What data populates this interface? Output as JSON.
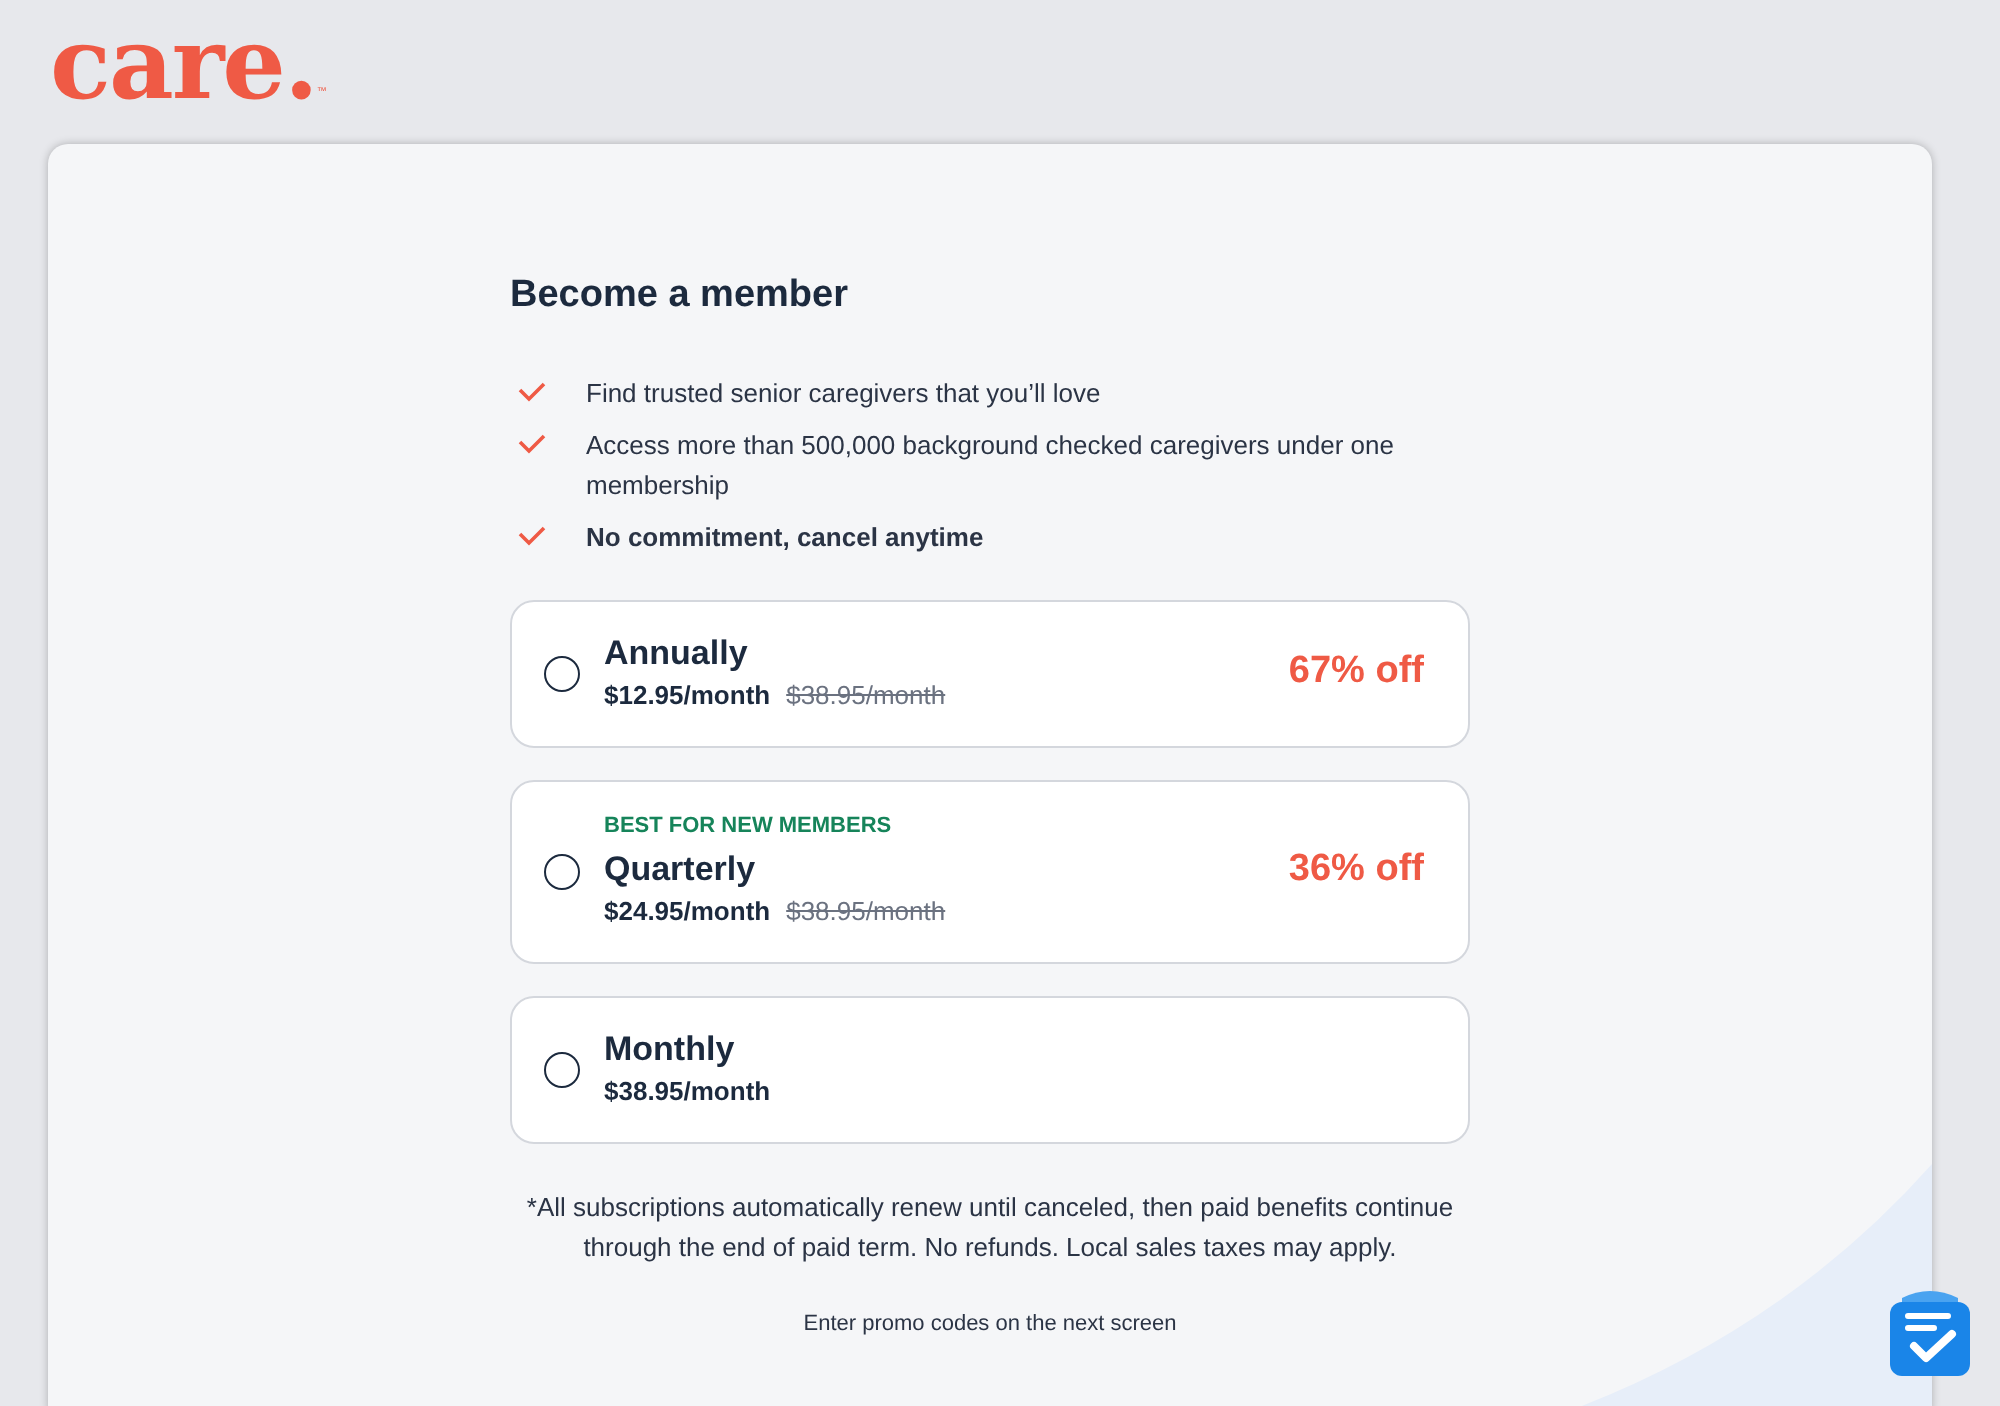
{
  "logo": {
    "text": "care.",
    "mark": "™"
  },
  "title": "Become a member",
  "benefits": [
    {
      "text": "Find trusted senior caregivers that you’ll love",
      "bold": false
    },
    {
      "text": "Access more than 500,000 background checked caregivers under one membership",
      "bold": false
    },
    {
      "text": "No commitment, cancel anytime",
      "bold": true
    }
  ],
  "plans": [
    {
      "name": "Annually",
      "price": "$12.95/month",
      "original_price": "$38.95/month",
      "discount": "67% off",
      "selected": false
    },
    {
      "badge": "BEST FOR NEW MEMBERS",
      "name": "Quarterly",
      "price": "$24.95/month",
      "original_price": "$38.95/month",
      "discount": "36% off",
      "selected": false
    },
    {
      "name": "Monthly",
      "price": "$38.95/month",
      "selected": false
    }
  ],
  "disclaimer": "*All subscriptions automatically renew until canceled, then paid benefits continue through the end of paid term. No refunds. Local sales taxes may apply.",
  "promo_note": "Enter promo codes on the next screen"
}
